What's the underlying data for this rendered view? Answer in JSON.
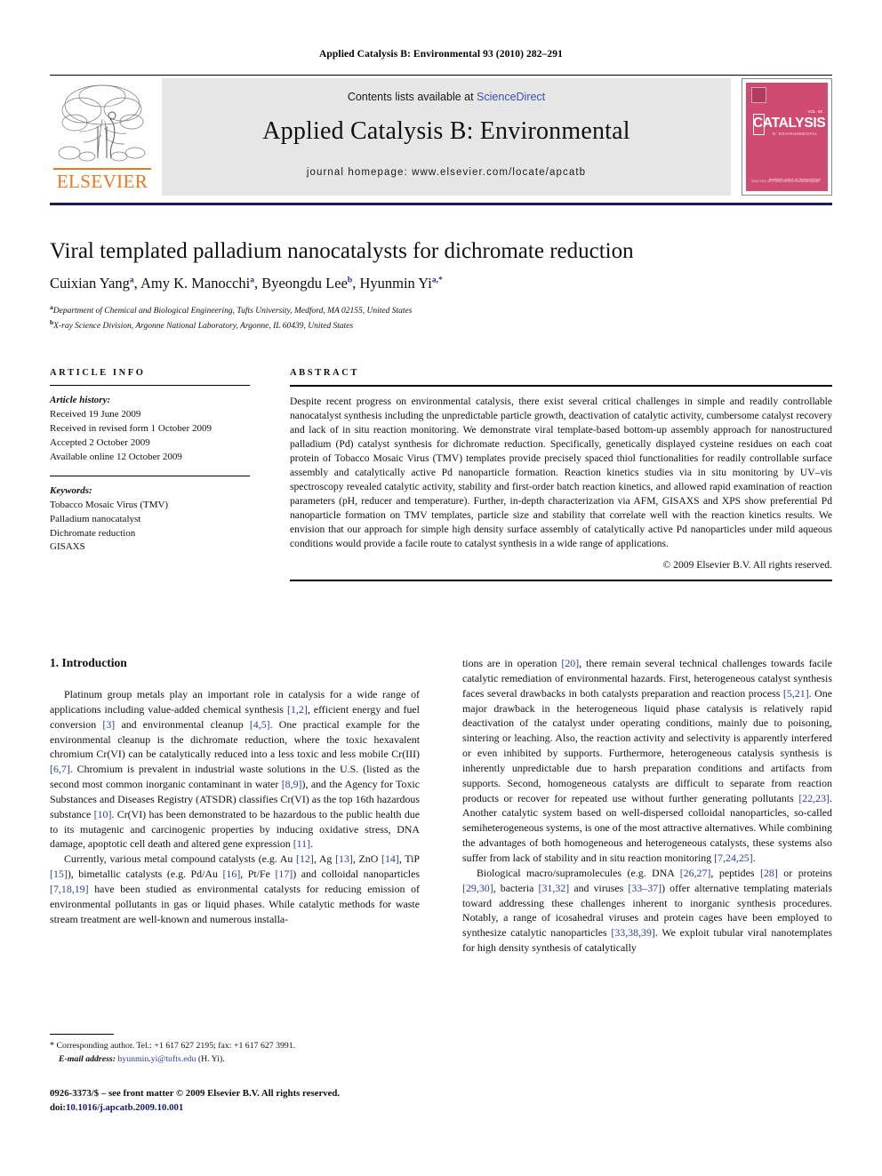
{
  "running_head": "Applied Catalysis B: Environmental 93 (2010) 282–291",
  "masthead": {
    "contents_prefix": "Contents lists available at ",
    "sciencedirect": "ScienceDirect",
    "journal_title": "Applied Catalysis B: Environmental",
    "homepage": "journal homepage: www.elsevier.com/locate/apcatb",
    "publisher_wordmark": "ELSEVIER",
    "cover": {
      "big_word": "CATALYSIS",
      "subtitle": "B: ENVIRONMENTAL",
      "volume": "VOL. 93",
      "footer_right": "Available online at\nScienceDirect",
      "footer_left": "ISSN 0926-3373\nwww.elsevier.com/locate/apcatb"
    },
    "accent_color": "#3a4fb8",
    "band_color": "#e6e6e6",
    "rule_color": "#1a1a5e",
    "cover_color": "#cf4b72",
    "elsevier_orange": "#e87722"
  },
  "article": {
    "title": "Viral templated palladium nanocatalysts for dichromate reduction",
    "authors_html": "Cuixian Yang<sup>a</sup>, Amy K. Manocchi<sup>a</sup>, Byeongdu Lee<sup>b</sup>, Hyunmin Yi<sup>a,*</sup>",
    "affiliation_a": "Department of Chemical and Biological Engineering, Tufts University, Medford, MA 02155, United States",
    "affiliation_b": "X-ray Science Division, Argonne National Laboratory, Argonne, IL 60439, United States"
  },
  "info": {
    "heading": "ARTICLE INFO",
    "history_label": "Article history:",
    "history": [
      "Received 19 June 2009",
      "Received in revised form 1 October 2009",
      "Accepted 2 October 2009",
      "Available online 12 October 2009"
    ],
    "keywords_label": "Keywords:",
    "keywords": [
      "Tobacco Mosaic Virus (TMV)",
      "Palladium nanocatalyst",
      "Dichromate reduction",
      "GISAXS"
    ]
  },
  "abstract": {
    "heading": "ABSTRACT",
    "text": "Despite recent progress on environmental catalysis, there exist several critical challenges in simple and readily controllable nanocatalyst synthesis including the unpredictable particle growth, deactivation of catalytic activity, cumbersome catalyst recovery and lack of in situ reaction monitoring. We demonstrate viral template-based bottom-up assembly approach for nanostructured palladium (Pd) catalyst synthesis for dichromate reduction. Specifically, genetically displayed cysteine residues on each coat protein of Tobacco Mosaic Virus (TMV) templates provide precisely spaced thiol functionalities for readily controllable surface assembly and catalytically active Pd nanoparticle formation. Reaction kinetics studies via in situ monitoring by UV–vis spectroscopy revealed catalytic activity, stability and first-order batch reaction kinetics, and allowed rapid examination of reaction parameters (pH, reducer and temperature). Further, in-depth characterization via AFM, GISAXS and XPS show preferential Pd nanoparticle formation on TMV templates, particle size and stability that correlate well with the reaction kinetics results. We envision that our approach for simple high density surface assembly of catalytically active Pd nanoparticles under mild aqueous conditions would provide a facile route to catalyst synthesis in a wide range of applications.",
    "copyright": "© 2009 Elsevier B.V. All rights reserved."
  },
  "body": {
    "section_1_title": "1. Introduction",
    "left_paragraphs": [
      "Platinum group metals play an important role in catalysis for a wide range of applications including value-added chemical synthesis <span class=\"ref\">[1,2]</span>, efficient energy and fuel conversion <span class=\"ref\">[3]</span> and environmental cleanup <span class=\"ref\">[4,5]</span>. One practical example for the environmental cleanup is the dichromate reduction, where the toxic hexavalent chromium Cr(VI) can be catalytically reduced into a less toxic and less mobile Cr(III) <span class=\"ref\">[6,7]</span>. Chromium is prevalent in industrial waste solutions in the U.S. (listed as the second most common inorganic contaminant in water <span class=\"ref\">[8,9]</span>), and the Agency for Toxic Substances and Diseases Registry (ATSDR) classifies Cr(VI) as the top 16th hazardous substance <span class=\"ref\">[10]</span>. Cr(VI) has been demonstrated to be hazardous to the public health due to its mutagenic and carcinogenic properties by inducing oxidative stress, DNA damage, apoptotic cell death and altered gene expression <span class=\"ref\">[11]</span>.",
      "Currently, various metal compound catalysts (e.g. Au <span class=\"ref\">[12]</span>, Ag <span class=\"ref\">[13]</span>, ZnO <span class=\"ref\">[14]</span>, TiP <span class=\"ref\">[15]</span>), bimetallic catalysts (e.g. Pd/Au <span class=\"ref\">[16]</span>, Pt/Fe <span class=\"ref\">[17]</span>) and colloidal nanoparticles <span class=\"ref\">[7,18,19]</span> have been studied as environmental catalysts for reducing emission of environmental pollutants in gas or liquid phases. While catalytic methods for waste stream treatment are well-known and numerous installa-"
    ],
    "right_paragraphs": [
      "tions are in operation <span class=\"ref\">[20]</span>, there remain several technical challenges towards facile catalytic remediation of environmental hazards. First, heterogeneous catalyst synthesis faces several drawbacks in both catalysts preparation and reaction process <span class=\"ref\">[5,21]</span>. One major drawback in the heterogeneous liquid phase catalysis is relatively rapid deactivation of the catalyst under operating conditions, mainly due to poisoning, sintering or leaching. Also, the reaction activity and selectivity is apparently interfered or even inhibited by supports. Furthermore, heterogeneous catalysis synthesis is inherently unpredictable due to harsh preparation conditions and artifacts from supports. Second, homogeneous catalysts are difficult to separate from reaction products or recover for repeated use without further generating pollutants <span class=\"ref\">[22,23]</span>. Another catalytic system based on well-dispersed colloidal nanoparticles, so-called semiheterogeneous systems, is one of the most attractive alternatives. While combining the advantages of both homogeneous and heterogeneous catalysts, these systems also suffer from lack of stability and in situ reaction monitoring <span class=\"ref\">[7,24,25]</span>.",
      "Biological macro/supramolecules (e.g. DNA <span class=\"ref\">[26,27]</span>, peptides <span class=\"ref\">[28]</span> or proteins <span class=\"ref\">[29,30]</span>, bacteria <span class=\"ref\">[31,32]</span> and viruses <span class=\"ref\">[33–37]</span>) offer alternative templating materials toward addressing these challenges inherent to inorganic synthesis procedures. Notably, a range of icosahedral viruses and protein cages have been employed to synthesize catalytic nanoparticles <span class=\"ref\">[33,38,39]</span>. We exploit tubular viral nanotemplates for high density synthesis of catalytically"
    ]
  },
  "footnote": {
    "corresponding": "Corresponding author. Tel.: +1 617 627 2195; fax: +1 617 627 3991.",
    "email_label": "E-mail address:",
    "email": "hyunmin.yi@tufts.edu",
    "email_suffix": "(H. Yi)."
  },
  "footer": {
    "issn_line": "0926-3373/$ – see front matter © 2009 Elsevier B.V. All rights reserved.",
    "doi_label": "doi:",
    "doi": "10.1016/j.apcatb.2009.10.001"
  }
}
